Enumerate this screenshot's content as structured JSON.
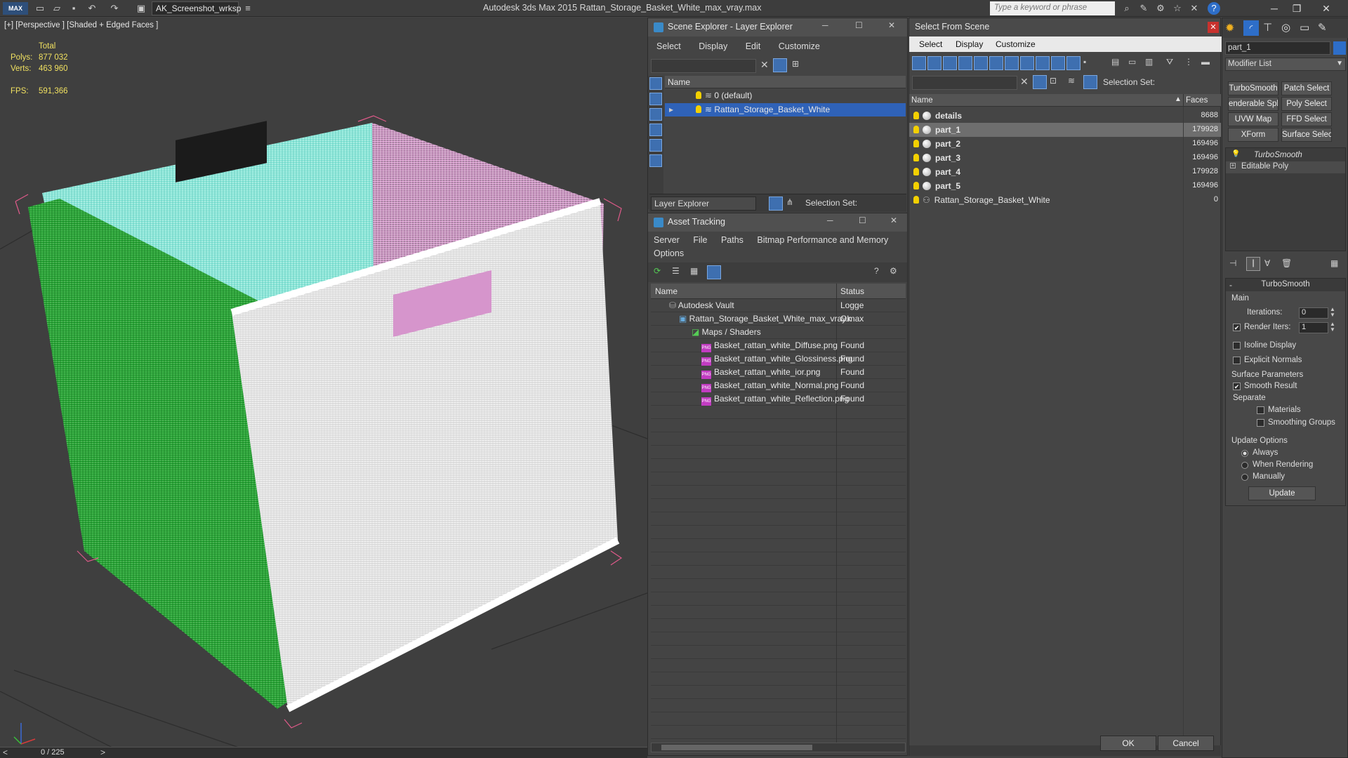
{
  "app": {
    "title": "Autodesk 3ds Max  2015     Rattan_Storage_Basket_White_max_vray.max",
    "workspace": "AK_Screenshot_wrksp",
    "logo": "MAX",
    "search_placeholder": "Type a keyword or phrase"
  },
  "viewport": {
    "label": "[+] [Perspective ] [Shaded + Edged Faces ]",
    "stats": {
      "total_label": "Total",
      "polys_label": "Polys:",
      "polys": "877 032",
      "verts_label": "Verts:",
      "verts": "463 960",
      "fps_label": "FPS:",
      "fps": "591,366"
    },
    "timeline": "0 / 225"
  },
  "scene_explorer": {
    "title": "Scene Explorer - Layer Explorer",
    "menu": [
      "Select",
      "Display",
      "Edit",
      "Customize"
    ],
    "column": "Name",
    "layers": [
      "0 (default)",
      "Rattan_Storage_Basket_White"
    ],
    "footer_label": "Layer Explorer",
    "selection_set": "Selection Set:"
  },
  "asset_tracking": {
    "title": "Asset Tracking",
    "menu": [
      "Server",
      "File",
      "Paths",
      "Bitmap Performance and Memory"
    ],
    "menu2": "Options",
    "col_name": "Name",
    "col_status": "Status",
    "rows": [
      {
        "name": "Autodesk Vault",
        "status": "Logge"
      },
      {
        "name": "Rattan_Storage_Basket_White_max_vray.max",
        "status": "Ok"
      },
      {
        "name": "Maps / Shaders",
        "status": ""
      },
      {
        "name": "Basket_rattan_white_Diffuse.png",
        "status": "Found"
      },
      {
        "name": "Basket_rattan_white_Glossiness.png",
        "status": "Found"
      },
      {
        "name": "Basket_rattan_white_ior.png",
        "status": "Found"
      },
      {
        "name": "Basket_rattan_white_Normal.png",
        "status": "Found"
      },
      {
        "name": "Basket_rattan_white_Reflection.png",
        "status": "Found"
      }
    ]
  },
  "select_from_scene": {
    "title": "Select From Scene",
    "menu": [
      "Select",
      "Display",
      "Customize"
    ],
    "selection_set": "Selection Set:",
    "col_name": "Name",
    "col_faces": "Faces",
    "rows": [
      {
        "name": "details",
        "faces": "8688"
      },
      {
        "name": "part_1",
        "faces": "179928"
      },
      {
        "name": "part_2",
        "faces": "169496"
      },
      {
        "name": "part_3",
        "faces": "169496"
      },
      {
        "name": "part_4",
        "faces": "179928"
      },
      {
        "name": "part_5",
        "faces": "169496"
      },
      {
        "name": "Rattan_Storage_Basket_White",
        "faces": "0"
      }
    ],
    "ok": "OK",
    "cancel": "Cancel"
  },
  "command_panel": {
    "object_name": "part_1",
    "modifier_list": "Modifier List",
    "buttons": [
      "TurboSmooth",
      "Patch Select",
      "enderable Splin",
      "Poly Select",
      "UVW Map",
      "FFD Select",
      "XForm",
      "Surface Select"
    ],
    "stack": [
      "TurboSmooth",
      "Editable Poly"
    ],
    "rollout_title": "TurboSmooth",
    "main_label": "Main",
    "iterations_label": "Iterations:",
    "iterations": "0",
    "render_iters_label": "Render Iters:",
    "render_iters": "1",
    "isoline": "Isoline Display",
    "explicit_normals": "Explicit Normals",
    "surface_params": "Surface Parameters",
    "smooth_result": "Smooth Result",
    "separate": "Separate",
    "materials": "Materials",
    "smoothing_groups": "Smoothing Groups",
    "update_options": "Update Options",
    "always": "Always",
    "when_rendering": "When Rendering",
    "manually": "Manually",
    "update_btn": "Update"
  }
}
